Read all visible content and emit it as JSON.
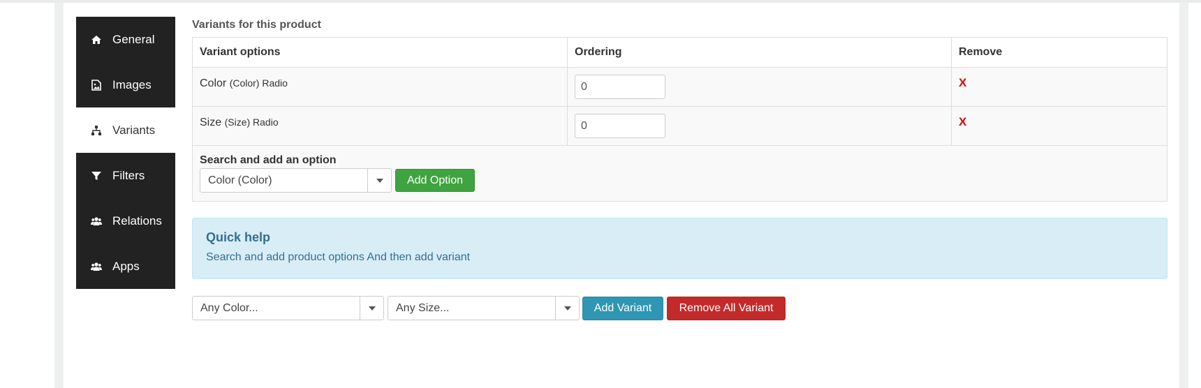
{
  "sidebar": {
    "items": [
      {
        "label": "General",
        "icon": "home-icon",
        "active": false
      },
      {
        "label": "Images",
        "icon": "image-icon",
        "active": false
      },
      {
        "label": "Variants",
        "icon": "sitemap-icon",
        "active": true
      },
      {
        "label": "Filters",
        "icon": "filter-icon",
        "active": false
      },
      {
        "label": "Relations",
        "icon": "users-icon",
        "active": false
      },
      {
        "label": "Apps",
        "icon": "users-icon",
        "active": false
      }
    ]
  },
  "main": {
    "title": "Variants for this product",
    "table": {
      "headers": [
        "Variant options",
        "Ordering",
        "Remove"
      ],
      "rows": [
        {
          "name": "Color",
          "detail": "(Color) Radio",
          "ordering": "0",
          "remove": "X"
        },
        {
          "name": "Size",
          "detail": "(Size) Radio",
          "ordering": "0",
          "remove": "X"
        }
      ],
      "add_option": {
        "label": "Search and add an option",
        "selected": "Color (Color)",
        "button": "Add Option"
      }
    },
    "help": {
      "title": "Quick help",
      "text": "Search and add product options And then add variant"
    },
    "variant_controls": {
      "color_select": "Any Color...",
      "size_select": "Any Size...",
      "add_button": "Add Variant",
      "remove_all_button": "Remove All Variant"
    }
  },
  "colors": {
    "sidebar_bg": "#222222",
    "add_option_button": "#3fa43f",
    "add_variant_button": "#2f96b4",
    "remove_all_button": "#c32a2a",
    "remove_x": "#e00000",
    "help_bg": "#d9edf7"
  }
}
